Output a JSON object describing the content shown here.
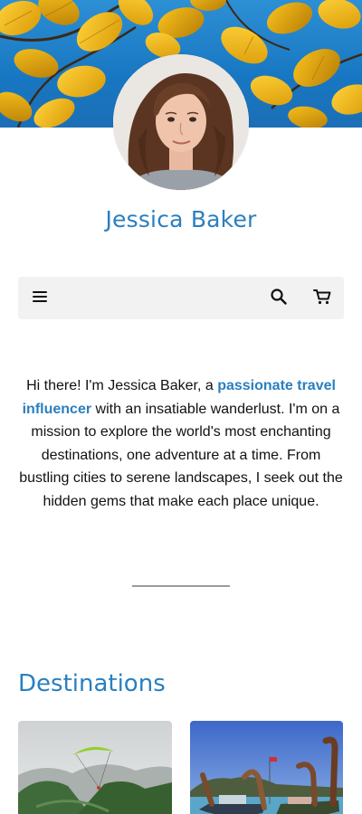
{
  "profile": {
    "name": "Jessica Baker"
  },
  "nav": {
    "menu_icon": "menu-icon",
    "search_icon": "search-icon",
    "cart_icon": "cart-icon"
  },
  "bio": {
    "before": "Hi there! I'm Jessica Baker, a ",
    "highlight": "passionate travel influencer",
    "after": " with an insatiable wanderlust. I'm on a mission to explore the world's most enchanting destinations, one adventure at a time. From bustling cities to serene landscapes, I seek out the hidden gems that make each place unique."
  },
  "destinations": {
    "title": "Destinations",
    "cards": [
      {
        "image": "paragliding-over-green-mountains"
      },
      {
        "image": "longtail-boats-tropical-beach"
      }
    ]
  },
  "colors": {
    "accent": "#2a7fc0",
    "navbar_bg": "#f2f2f2",
    "divider": "#9a9a9a"
  }
}
